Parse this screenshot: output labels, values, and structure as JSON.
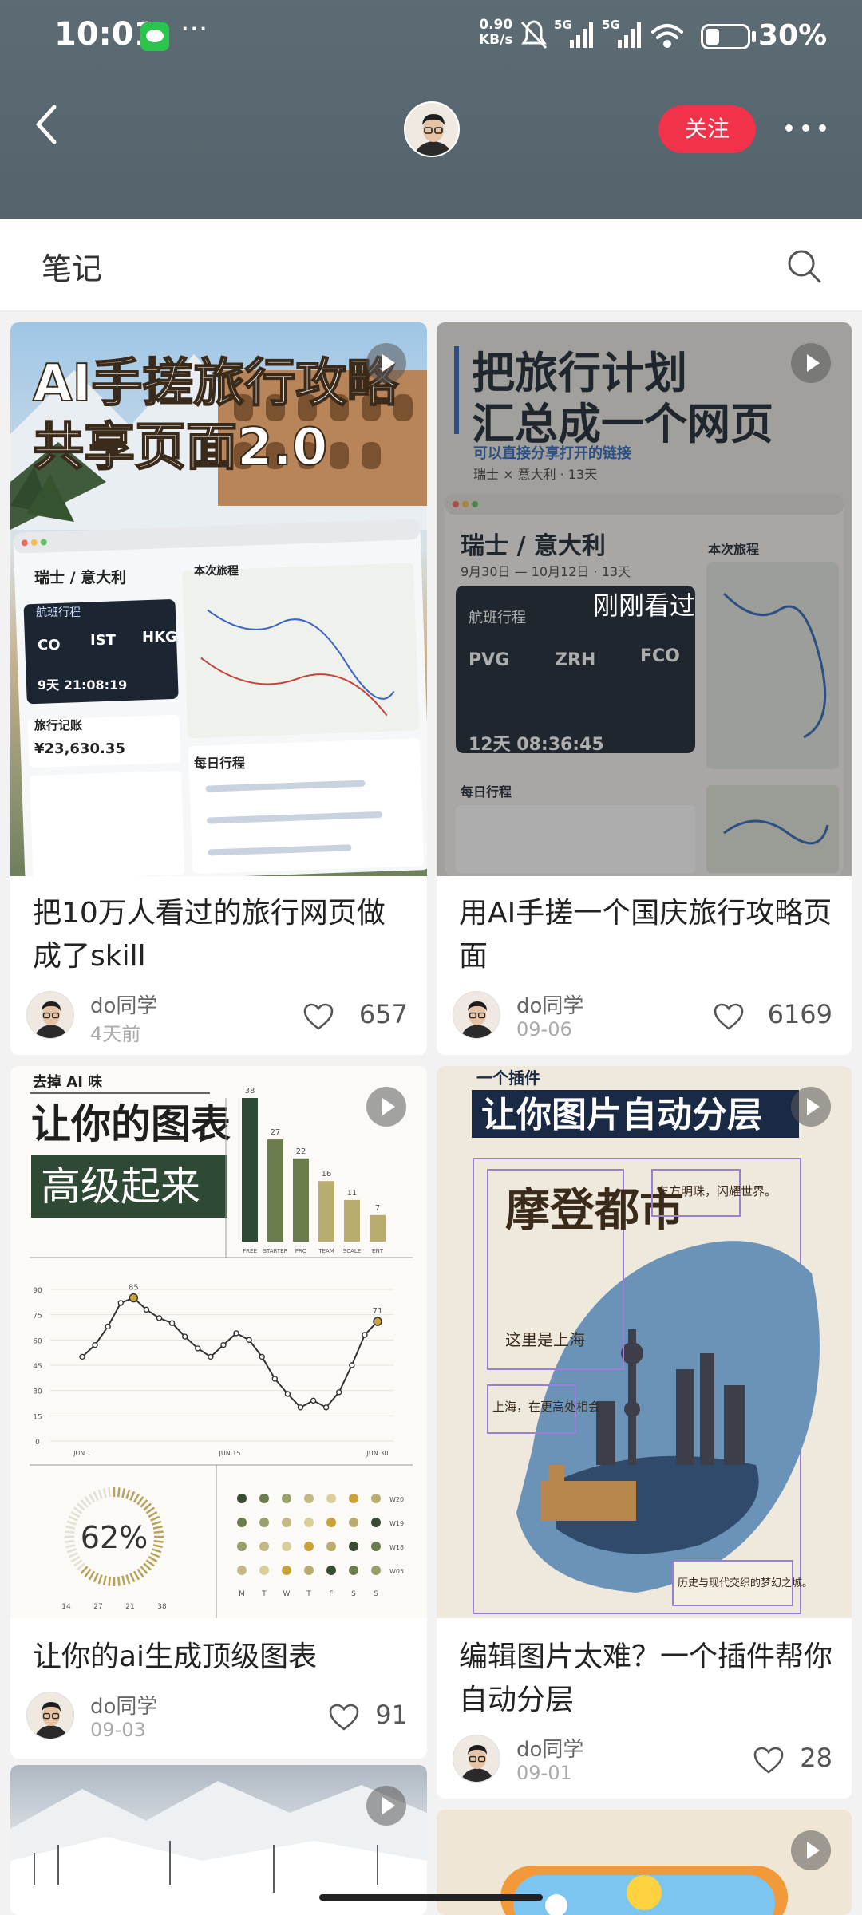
{
  "status": {
    "time": "10:01",
    "net_speed_top": "0.90",
    "net_speed_bottom": "KB/s",
    "battery": "30%"
  },
  "header": {
    "follow_label": "关注"
  },
  "tabs": {
    "notes_label": "笔记"
  },
  "cards": [
    {
      "title": "把10万人看过的旅行网页做成了skill",
      "author": "do同学",
      "date": "4天前",
      "likes": "657",
      "thumb_title_1": "AI手搓旅行攻略",
      "thumb_title_2": "共享页面2.0",
      "thumb_trip": "瑞士 / 意大利",
      "thumb_section": "本次旅程",
      "thumb_flight_label": "航班行程",
      "thumb_codes": [
        "CO",
        "IST",
        "HKG"
      ],
      "thumb_countdown": "9天 21:08:19",
      "thumb_budget_label": "旅行记账",
      "thumb_budget": "¥23,630.35",
      "thumb_daily": "每日行程"
    },
    {
      "title": "用AI手搓一个国庆旅行攻略页面",
      "author": "do同学",
      "date": "09-06",
      "likes": "6169",
      "seen_label": "刚刚看过",
      "thumb_title_1": "把旅行计划",
      "thumb_title_2": "汇总成一个网页",
      "thumb_sub": "可以直接分享打开的链接",
      "thumb_sub2": "瑞士 × 意大利 · 13天",
      "thumb_trip": "瑞士 / 意大利",
      "thumb_dates": "9月30日 — 10月12日 · 13天",
      "thumb_section": "本次旅程",
      "thumb_flight_label": "航班行程",
      "thumb_codes": [
        "PVG",
        "ZRH",
        "FCO"
      ],
      "thumb_countdown": "12天 08:36:45",
      "thumb_daily": "每日行程"
    },
    {
      "title": "让你的ai生成顶级图表",
      "author": "do同学",
      "date": "09-03",
      "likes": "91",
      "thumb_kicker": "去掉 AI 味",
      "thumb_title_1": "让你的图表",
      "thumb_title_2": "高级起来",
      "thumb_pct": "62%"
    },
    {
      "title": "编辑图片太难？一个插件帮你自动分层",
      "author": "do同学",
      "date": "09-01",
      "likes": "28",
      "thumb_kicker": "一个插件",
      "thumb_title_1": "让你图片自动分层",
      "thumb_poster": "摩登都市",
      "thumb_poster_sub": "这里是上海",
      "thumb_note1": "东方明珠，闪耀世界。",
      "thumb_note2": "上海，在更高处相会",
      "thumb_note3": "历史与现代交织的梦幻之城。"
    }
  ],
  "mini_chart": {
    "bar_values": [
      38,
      27,
      22,
      16,
      11,
      7
    ],
    "bar_categories": [
      "FREE",
      "STARTER",
      "PRO",
      "TEAM",
      "SCALE",
      "ENT"
    ],
    "line_values": [
      50,
      57,
      68,
      82,
      85,
      78,
      73,
      70,
      62,
      55,
      50,
      57,
      64,
      60,
      50,
      37,
      28,
      20,
      24,
      20,
      29,
      45,
      63,
      71
    ],
    "line_x_labels": [
      "JUN 1",
      "JUN 15",
      "JUN 30"
    ],
    "line_y_ticks": [
      "90",
      "75",
      "60",
      "45",
      "30",
      "15",
      "0"
    ],
    "week_labels": [
      "M",
      "T",
      "W",
      "T",
      "F",
      "S",
      "S"
    ],
    "week_rows": [
      "W20",
      "W19",
      "W18",
      "W05"
    ],
    "donut_ticks": [
      "14",
      "27",
      "21",
      "38"
    ]
  }
}
